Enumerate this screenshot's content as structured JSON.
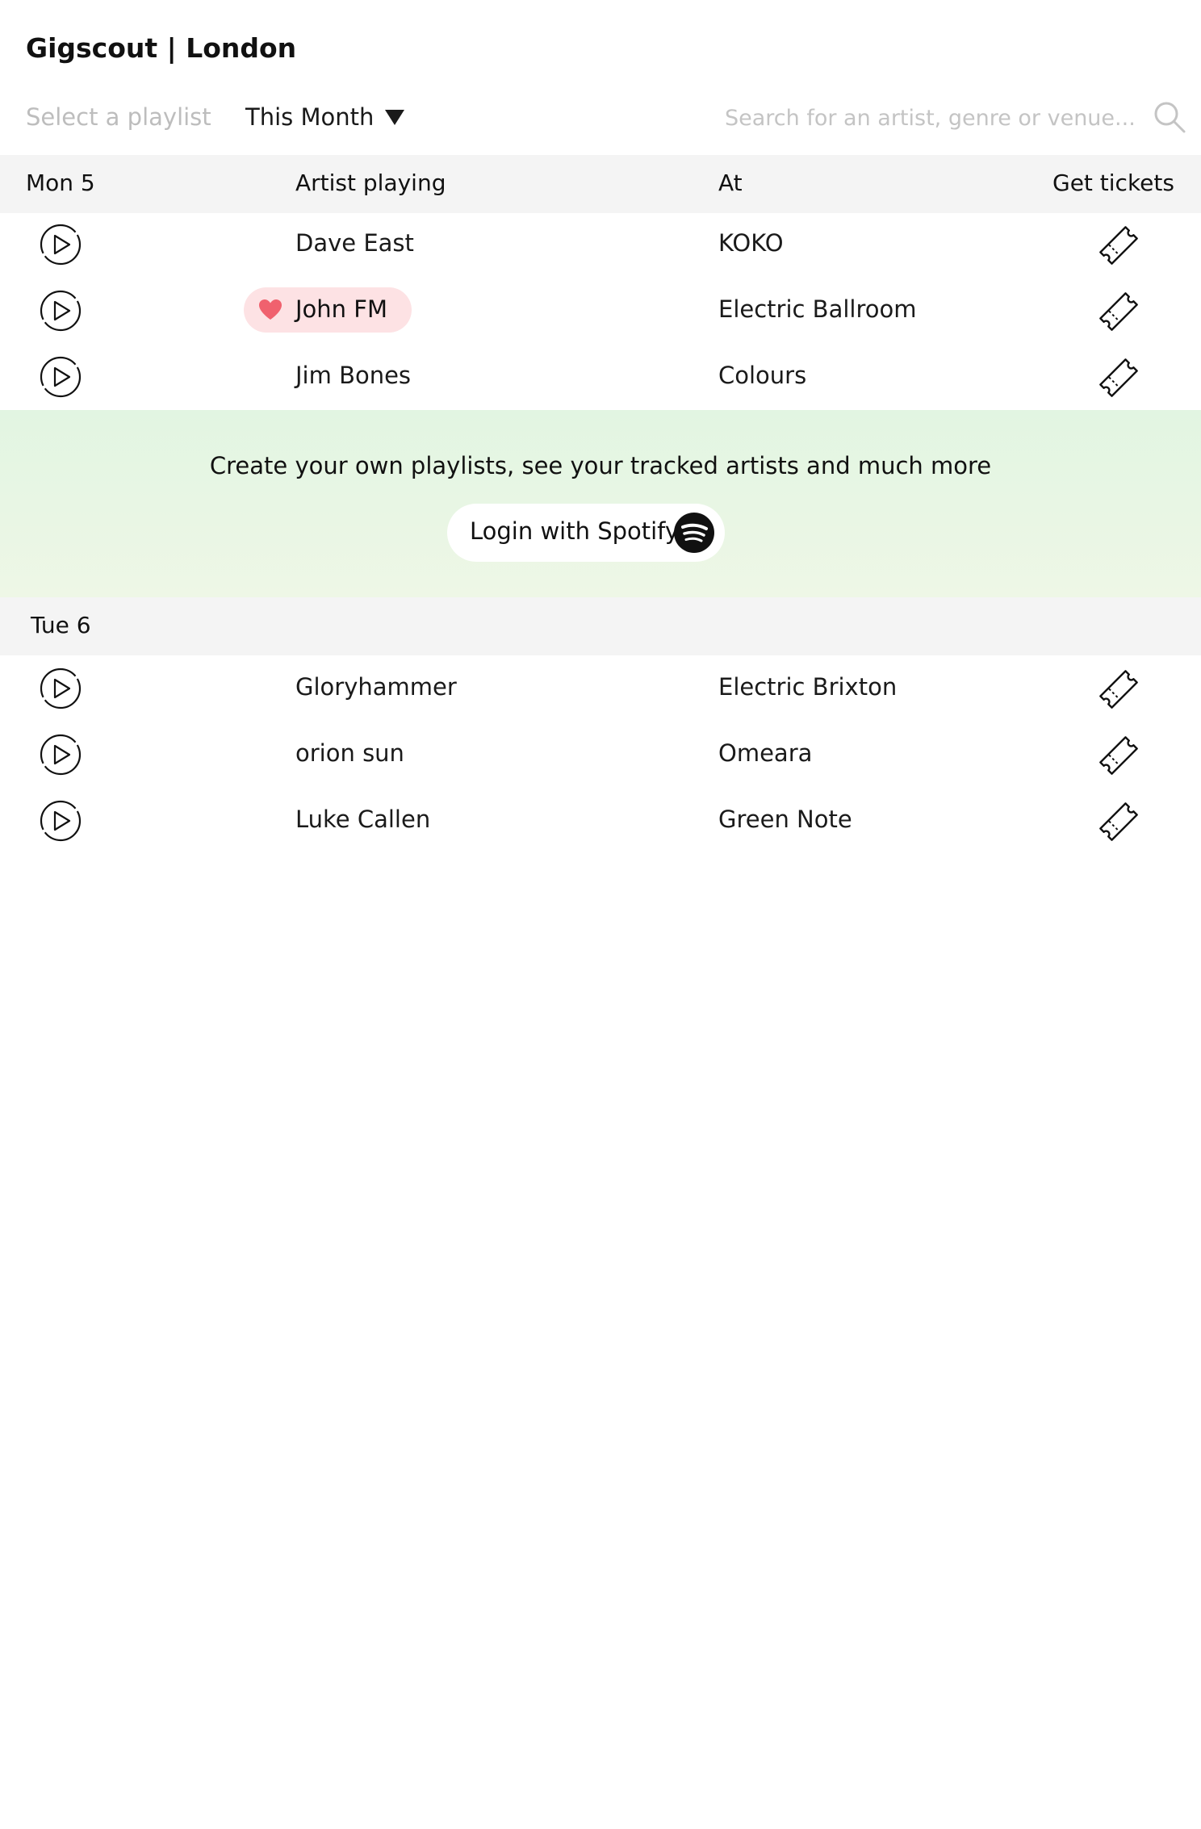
{
  "app": {
    "title": "Gigscout | London"
  },
  "toolbar": {
    "playlist_placeholder": "Select a playlist",
    "period": "This Month",
    "search_placeholder": "Search for an artist, genre or venue..."
  },
  "columns": {
    "artist": "Artist playing",
    "venue": "At",
    "tickets": "Get tickets"
  },
  "days": [
    {
      "label": "Mon 5",
      "gigs": [
        {
          "artist": "Dave East",
          "venue": "KOKO",
          "favorite": false
        },
        {
          "artist": "John FM",
          "venue": "Electric Ballroom",
          "favorite": true
        },
        {
          "artist": "Jim Bones",
          "venue": "Colours",
          "favorite": false
        }
      ]
    },
    {
      "label": "Tue 6",
      "gigs": [
        {
          "artist": "Gloryhammer",
          "venue": "Electric Brixton",
          "favorite": false
        },
        {
          "artist": "orion sun",
          "venue": "Omeara",
          "favorite": false
        },
        {
          "artist": "Luke Callen",
          "venue": "Green Note",
          "favorite": false
        }
      ]
    }
  ],
  "promo": {
    "text": "Create your own playlists, see your tracked artists and much more",
    "button_label": "Login with Spotify"
  },
  "icons": {
    "play": "play-icon",
    "ticket": "ticket-icon",
    "heart": "heart-icon",
    "spotify": "spotify-icon",
    "search": "search-icon",
    "caret": "caret-down-icon"
  },
  "colors": {
    "favorite_pill": "#fde2e4",
    "heart": "#f0616e",
    "promo_bg": "#e2f5e2",
    "header_bg": "#f4f4f4",
    "placeholder": "#bdbdbd"
  }
}
